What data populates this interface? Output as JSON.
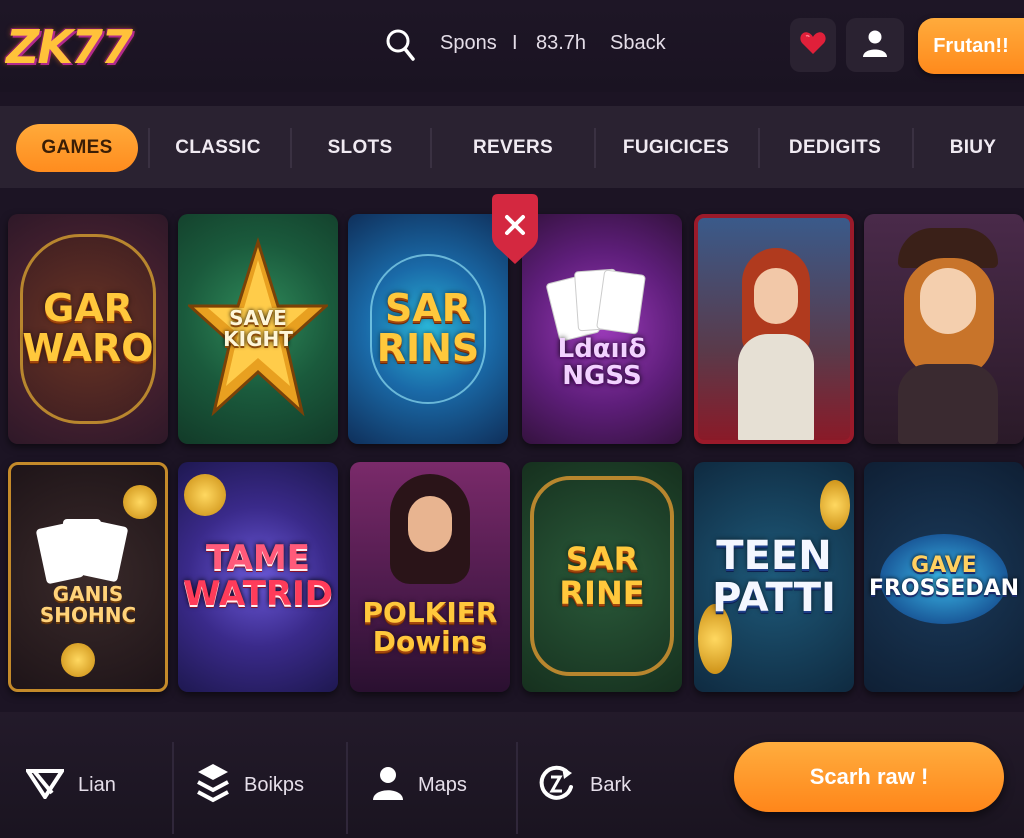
{
  "header": {
    "logo": "ZK77",
    "search_icon": "search-icon",
    "stat1": "Spons",
    "stat_divider": "I",
    "stat2": "83.7h",
    "stat3": "Sback",
    "favorite_icon": "heart-icon",
    "user_icon": "user-icon",
    "cta_label": "Frutan!!"
  },
  "nav": {
    "tabs": [
      {
        "label": "GAMES",
        "active": true
      },
      {
        "label": "CLASSIC"
      },
      {
        "label": "SLOTS"
      },
      {
        "label": "REVERS"
      },
      {
        "label": "FUGICICES"
      },
      {
        "label": "DEDIGITS"
      },
      {
        "label": "BIUY"
      }
    ]
  },
  "games": {
    "close_icon": "close-icon",
    "tiles": [
      {
        "title_line1": "GAR",
        "title_line2": "WARO"
      },
      {
        "title_line1": "SAVE",
        "title_line2": "KIGHT"
      },
      {
        "title_line1": "SAR",
        "title_line2": "RINS"
      },
      {
        "title_line1": "Ldαııδ",
        "title_line2": "NGSS"
      },
      {
        "title_line1": "",
        "title_line2": ""
      },
      {
        "title_line1": "",
        "title_line2": ""
      },
      {
        "title_line1": "GANIS",
        "title_line2": "SHOHNC"
      },
      {
        "title_line1": "TAME",
        "title_line2": "WATRID"
      },
      {
        "title_line1": "POLKIER",
        "title_line2": "Dowins"
      },
      {
        "title_line1": "SAR",
        "title_line2": "RINE"
      },
      {
        "title_line1": "TEEN",
        "title_line2": "PATTI"
      },
      {
        "title_line1": "GAVE",
        "title_line2": "FROSSEDAN"
      }
    ]
  },
  "bottom": {
    "items": [
      {
        "label": "Lian",
        "icon": "lian-icon"
      },
      {
        "label": "Boikps",
        "icon": "layers-icon"
      },
      {
        "label": "Maps",
        "icon": "user-icon"
      },
      {
        "label": "Bark",
        "icon": "refresh-icon"
      }
    ],
    "cta_label": "Scarh raw !"
  },
  "colors": {
    "background": "#1c1424",
    "panel": "#2a2231",
    "accent_orange": "#ff9a2c",
    "accent_red": "#d42840"
  }
}
